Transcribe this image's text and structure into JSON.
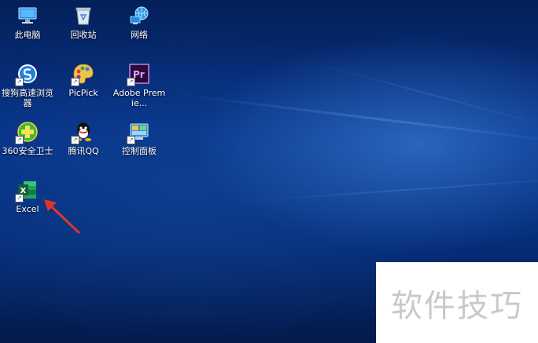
{
  "desktop": {
    "icons": [
      {
        "label": "此电脑",
        "icon": "computer-icon"
      },
      {
        "label": "回收站",
        "icon": "recycle-bin-icon"
      },
      {
        "label": "网络",
        "icon": "network-icon"
      },
      {
        "label": "搜狗高速浏览器",
        "icon": "sogou-browser-icon"
      },
      {
        "label": "PicPick",
        "icon": "picpick-icon"
      },
      {
        "label": "Adobe Premie...",
        "icon": "adobe-premiere-icon"
      },
      {
        "label": "360安全卫士",
        "icon": "360-security-icon"
      },
      {
        "label": "腾讯QQ",
        "icon": "qq-icon"
      },
      {
        "label": "控制面板",
        "icon": "control-panel-icon"
      },
      {
        "label": "Excel",
        "icon": "excel-icon"
      }
    ]
  },
  "watermark": {
    "text": "软件技巧"
  },
  "colors": {
    "accent_arrow": "#e0352b",
    "excel_green": "#1e7145"
  }
}
